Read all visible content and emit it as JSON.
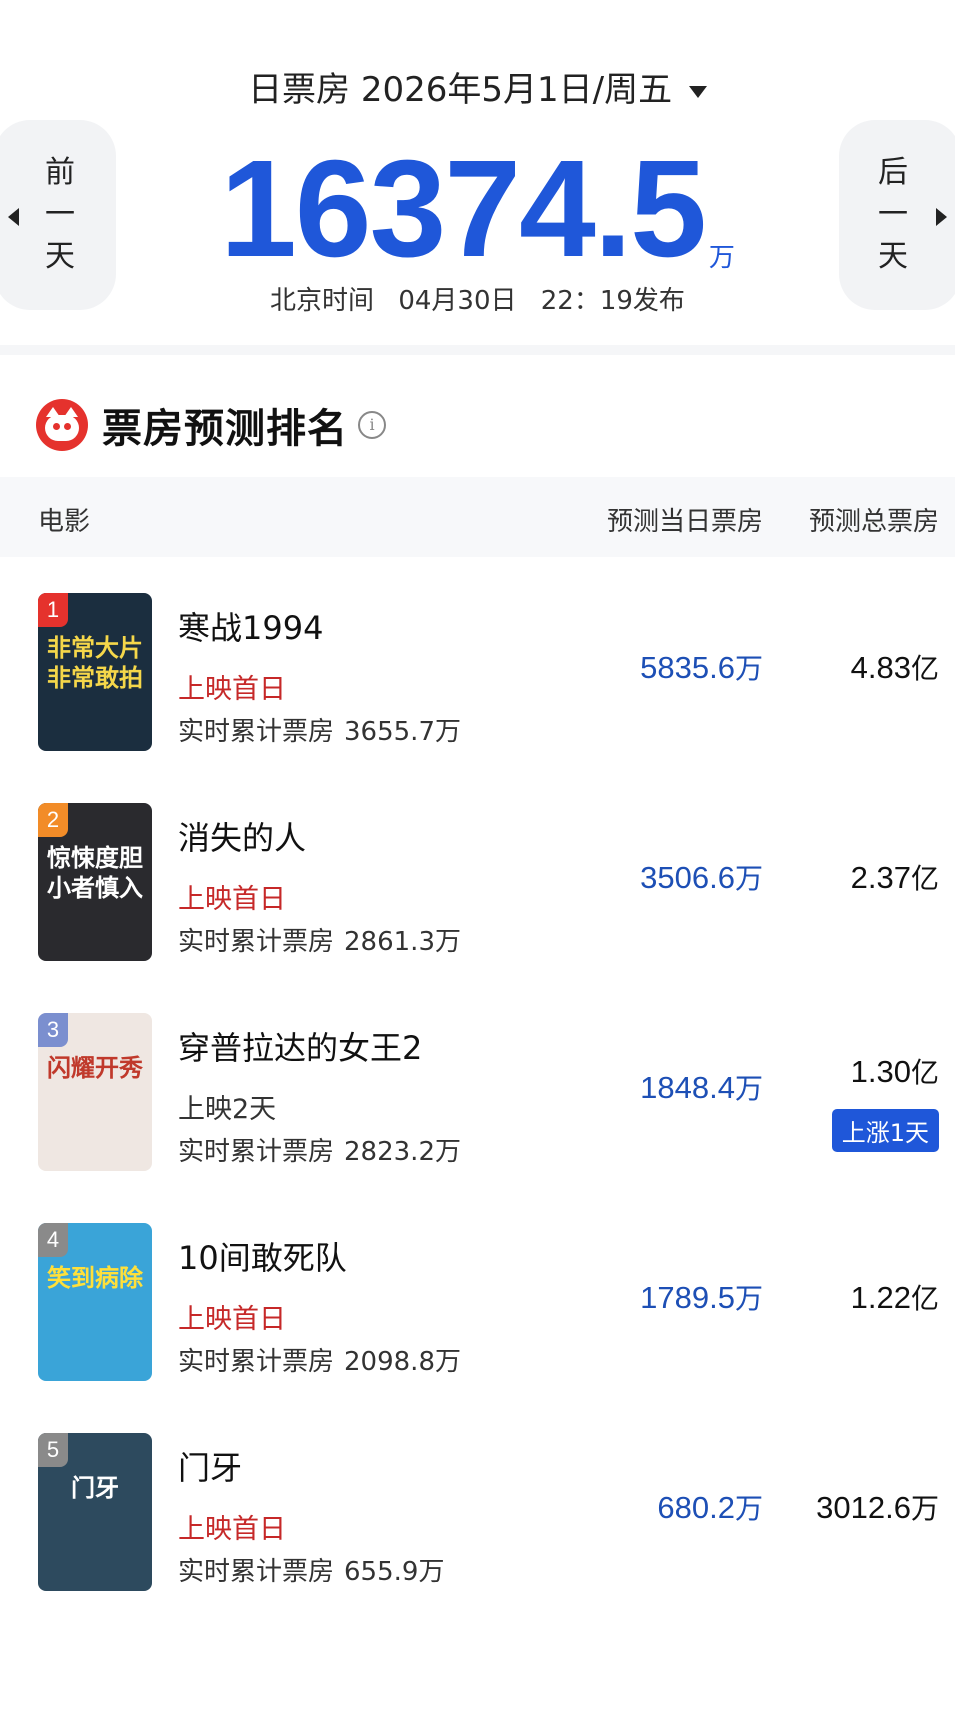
{
  "header": {
    "date_prefix": "日票房",
    "date": "2026年5月1日/周五",
    "total_value": "16374.5",
    "total_unit": "万",
    "release_label": "北京时间",
    "release_date": "04月30日",
    "release_time": "22：19发布",
    "prev_label": "前一天",
    "next_label": "后一天"
  },
  "ranking": {
    "title": "票房预测排名",
    "info_icon": "i",
    "columns": {
      "movie": "电影",
      "day_forecast": "预测当日票房",
      "total_forecast": "预测总票房"
    },
    "rows": [
      {
        "rank": "1",
        "rank_color": "#e5322d",
        "name": "寒战1994",
        "status": "上映首日",
        "status_color": "#c62828",
        "cum_label": "实时累计票房",
        "cum_value": "3655.7万",
        "poster_text": "非常大片非常敢拍",
        "poster_bg": "#1b2e3f",
        "poster_fg": "#f5d74a",
        "day_value": "5835.6",
        "day_unit": "万",
        "total_value": "4.83",
        "total_unit": "亿",
        "tag": ""
      },
      {
        "rank": "2",
        "rank_color": "#f28c28",
        "name": "消失的人",
        "status": "上映首日",
        "status_color": "#c62828",
        "cum_label": "实时累计票房",
        "cum_value": "2861.3万",
        "poster_text": "惊悚度胆小者慎入",
        "poster_bg": "#2a2a2e",
        "poster_fg": "#ffffff",
        "day_value": "3506.6",
        "day_unit": "万",
        "total_value": "2.37",
        "total_unit": "亿",
        "tag": ""
      },
      {
        "rank": "3",
        "rank_color": "#7b8fcf",
        "name": "穿普拉达的女王2",
        "status": "上映2天",
        "status_color": "#333333",
        "cum_label": "实时累计票房",
        "cum_value": "2823.2万",
        "poster_text": "闪耀开秀",
        "poster_bg": "#efe7e2",
        "poster_fg": "#c0392b",
        "day_value": "1848.4",
        "day_unit": "万",
        "total_value": "1.30",
        "total_unit": "亿",
        "tag": "上涨1天"
      },
      {
        "rank": "4",
        "rank_color": "#8a8a8a",
        "name": "10间敢死队",
        "status": "上映首日",
        "status_color": "#c62828",
        "cum_label": "实时累计票房",
        "cum_value": "2098.8万",
        "poster_text": "笑到病除",
        "poster_bg": "#3aa4d8",
        "poster_fg": "#ffe03a",
        "day_value": "1789.5",
        "day_unit": "万",
        "total_value": "1.22",
        "total_unit": "亿",
        "tag": ""
      },
      {
        "rank": "5",
        "rank_color": "#8a8a8a",
        "name": "门牙",
        "status": "上映首日",
        "status_color": "#c62828",
        "cum_label": "实时累计票房",
        "cum_value": "655.9万",
        "poster_text": "门牙",
        "poster_bg": "#2d4a5e",
        "poster_fg": "#ffffff",
        "day_value": "680.2",
        "day_unit": "万",
        "total_value": "3012.6",
        "total_unit": "万",
        "tag": ""
      }
    ]
  }
}
